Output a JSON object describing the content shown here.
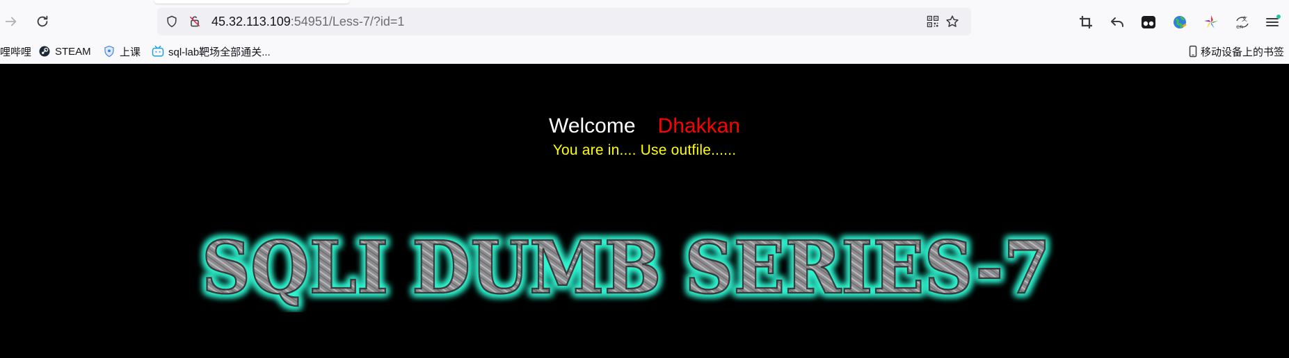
{
  "browser": {
    "url_host": "45.32.113.109",
    "url_rest": ":54951/Less-7/?id=1",
    "bookmarks": [
      {
        "label": "哩哔哩",
        "icon": "bilibili-icon"
      },
      {
        "label": "STEAM",
        "icon": "steam-icon"
      },
      {
        "label": "上课",
        "icon": "shield-bookmark-icon"
      },
      {
        "label": "sql-lab靶场全部通关...",
        "icon": "bilibili-tv-icon"
      }
    ],
    "mobile_bookmarks": "移动设备上的书签"
  },
  "page": {
    "welcome": "Welcome",
    "name": "Dhakkan",
    "status": "You are in.... Use outfile......",
    "banner_text": "SQLI DUMB SERIES-7"
  },
  "colors": {
    "page_bg": "#000000",
    "welcome": "#ffffff",
    "name": "#ff0000",
    "status": "#ffff00",
    "banner_glow": "#2ff5d0"
  }
}
